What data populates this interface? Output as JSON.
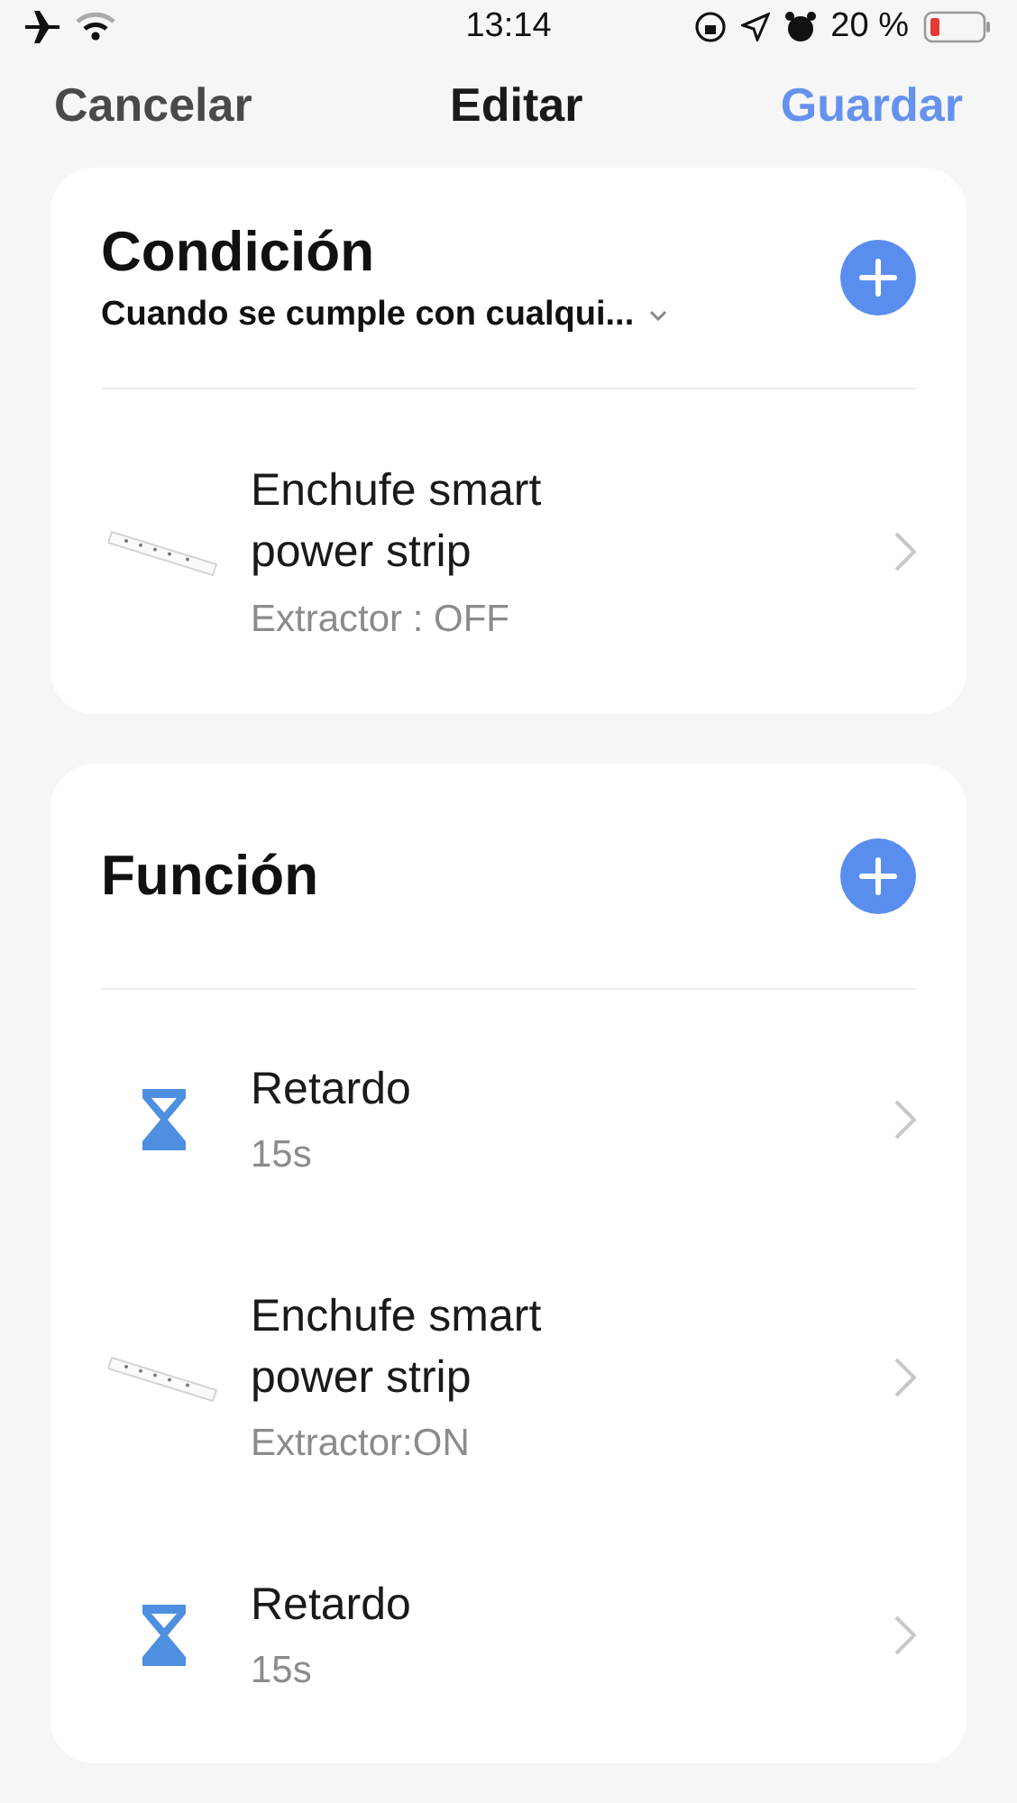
{
  "status_bar": {
    "time": "13:14",
    "battery": "20 %"
  },
  "nav": {
    "cancel": "Cancelar",
    "title": "Editar",
    "save": "Guardar"
  },
  "sections": [
    {
      "title": "Condición",
      "subtitle": "Cuando se cumple con cualqui...",
      "items": [
        {
          "kind": "device",
          "name": "Enchufe smart power strip",
          "detail": "Extractor : OFF"
        }
      ]
    },
    {
      "title": "Función",
      "items": [
        {
          "kind": "delay",
          "name": "Retardo",
          "detail": "15s"
        },
        {
          "kind": "device",
          "name": "Enchufe smart power strip",
          "detail": "Extractor:ON"
        },
        {
          "kind": "delay",
          "name": "Retardo",
          "detail": "15s"
        }
      ]
    }
  ]
}
